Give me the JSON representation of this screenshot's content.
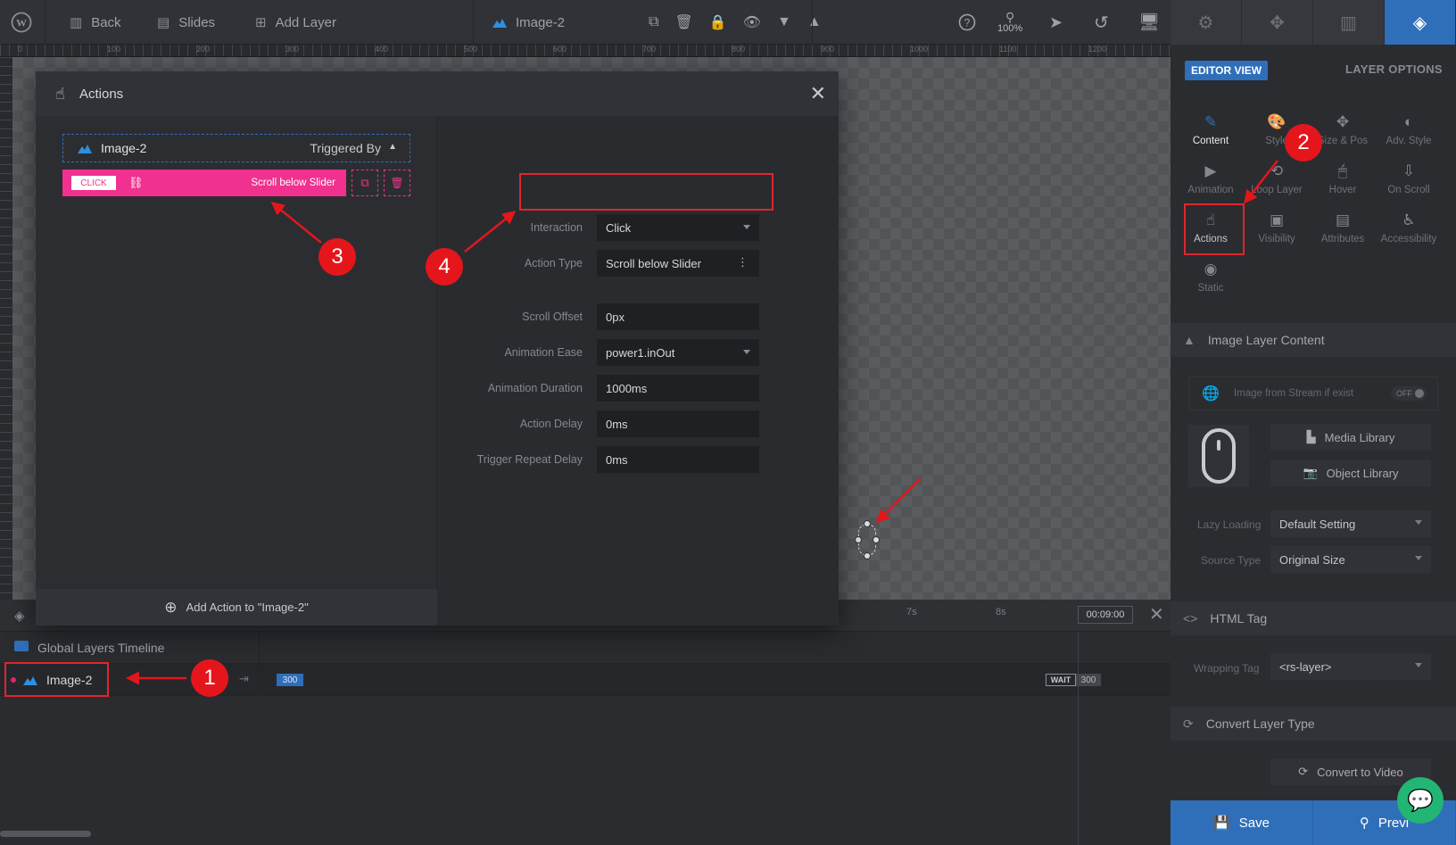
{
  "toolbar": {
    "back": "Back",
    "slides": "Slides",
    "add_layer": "Add Layer",
    "layer_name": "Image-2",
    "zoom": "100%"
  },
  "ruler": {
    "labels": [
      "0",
      "100",
      "200",
      "300",
      "400",
      "500",
      "600",
      "700",
      "800",
      "900",
      "1000",
      "1100",
      "1200"
    ]
  },
  "right_panel": {
    "editor_view": "EDITOR VIEW",
    "layer_options": "LAYER OPTIONS",
    "options": {
      "content": "Content",
      "style": "Style",
      "size_pos": "Size & Pos",
      "adv_style": "Adv. Style",
      "animation": "Animation",
      "loop_layer": "Loop Layer",
      "hover": "Hover",
      "on_scroll": "On Scroll",
      "actions": "Actions",
      "visibility": "Visibility",
      "attributes": "Attributes",
      "accessibility": "Accessibility",
      "static": "Static"
    },
    "image_layer_content": "Image Layer Content",
    "stream_label": "Image from Stream if exist",
    "stream_toggle": "OFF",
    "media_library": "Media Library",
    "object_library": "Object Library",
    "lazy_loading_label": "Lazy Loading",
    "lazy_loading_value": "Default Setting",
    "source_type_label": "Source Type",
    "source_type_value": "Original Size",
    "html_tag": "HTML Tag",
    "wrapping_tag_label": "Wrapping Tag",
    "wrapping_tag_value": "<rs-layer>",
    "convert_layer_type": "Convert Layer Type",
    "convert_to_video": "Convert to Video",
    "save": "Save",
    "preview": "Previ"
  },
  "modal": {
    "title": "Actions",
    "layer_name": "Image-2",
    "triggered_by": "Triggered By",
    "action_tag": "CLICK",
    "action_name": "Scroll below Slider",
    "add_action": "Add Action to \"Image-2\"",
    "fields": {
      "interaction_label": "Interaction",
      "interaction_value": "Click",
      "action_type_label": "Action Type",
      "action_type_value": "Scroll below Slider",
      "scroll_offset_label": "Scroll Offset",
      "scroll_offset_value": "0px",
      "animation_ease_label": "Animation Ease",
      "animation_ease_value": "power1.inOut",
      "animation_duration_label": "Animation Duration",
      "animation_duration_value": "1000ms",
      "action_delay_label": "Action Delay",
      "action_delay_value": "0ms",
      "trigger_repeat_label": "Trigger Repeat Delay",
      "trigger_repeat_value": "0ms"
    }
  },
  "timeline": {
    "tick_7s": "7s",
    "tick_8s": "8s",
    "time": "00:09:00",
    "global_layers": "Global Layers Timeline",
    "layer_name": "Image-2",
    "start": "300",
    "wait": "WAIT",
    "end": "300"
  },
  "annotations": {
    "one": "1",
    "two": "2",
    "three": "3",
    "four": "4"
  },
  "colors": {
    "accent_blue": "#2f6fba",
    "action_pink": "#f0318f",
    "annotation_red": "#e4161c"
  }
}
